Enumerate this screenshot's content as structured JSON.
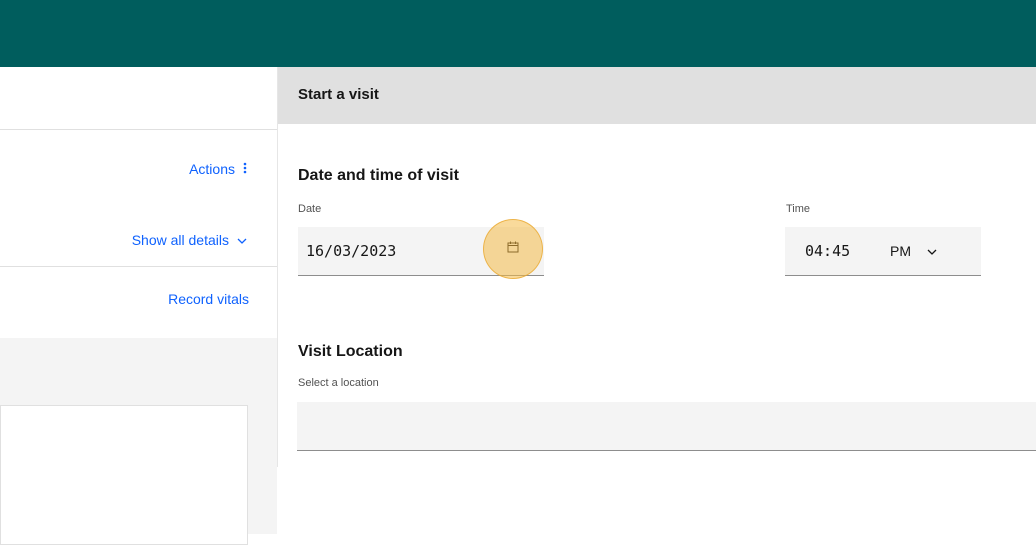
{
  "left_panel": {
    "actions_label": "Actions",
    "actions_icon": "overflow-menu-vertical-icon",
    "show_all_details_label": "Show all details",
    "show_all_details_icon": "chevron-down-icon",
    "record_vitals_label": "Record vitals"
  },
  "form": {
    "title": "Start a visit",
    "datetime_section_title": "Date and time of visit",
    "date_label": "Date",
    "date_value": "16/03/2023",
    "date_icon": "calendar-icon",
    "time_label": "Time",
    "time_value": "04:45",
    "time_period": "PM",
    "time_period_icon": "chevron-down-icon",
    "location_section_title": "Visit Location",
    "location_label": "Select a location",
    "location_value": ""
  },
  "colors": {
    "header": "#005d5d",
    "link": "#0f62fe",
    "highlight": "#f4bc48"
  }
}
